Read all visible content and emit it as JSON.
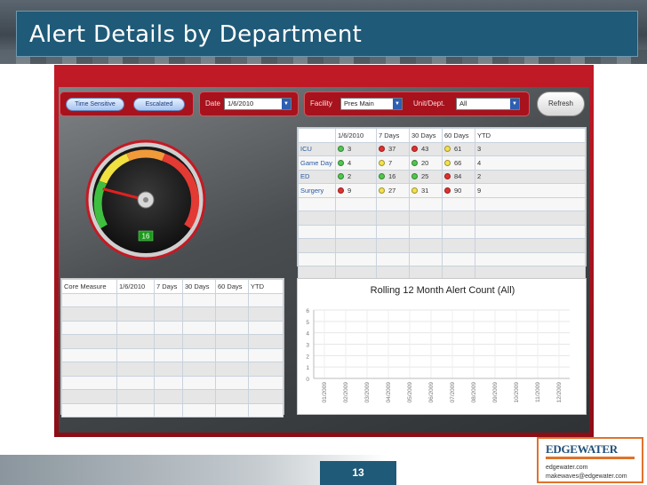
{
  "slide": {
    "title": "Alert Details by Department",
    "page_number": "13"
  },
  "toolbar": {
    "time_sensitive_label": "Time Sensitive",
    "escalated_label": "Escalated",
    "date_label": "Date",
    "date_value": "1/6/2010",
    "facility_label": "Facility",
    "facility_value": "Pres Main",
    "unit_label": "Unit/Dept.",
    "unit_value": "All",
    "refresh_label": "Refresh"
  },
  "gauge": {
    "value_label": "16",
    "fraction": 0.22
  },
  "dept_table": {
    "headers": [
      "",
      "1/6/2010",
      "7 Days",
      "30 Days",
      "60 Days",
      "YTD"
    ],
    "rows": [
      {
        "name": "ICU",
        "cells": [
          {
            "status": "green",
            "value": "3"
          },
          {
            "status": "red",
            "value": "37"
          },
          {
            "status": "red",
            "value": "43"
          },
          {
            "status": "yellow",
            "value": "61"
          }
        ],
        "ytd": "3"
      },
      {
        "name": "Game Day",
        "cells": [
          {
            "status": "green",
            "value": "4"
          },
          {
            "status": "yellow",
            "value": "7"
          },
          {
            "status": "green",
            "value": "20"
          },
          {
            "status": "yellow",
            "value": "66"
          }
        ],
        "ytd": "4"
      },
      {
        "name": "ED",
        "cells": [
          {
            "status": "green",
            "value": "2"
          },
          {
            "status": "green",
            "value": "16"
          },
          {
            "status": "green",
            "value": "25"
          },
          {
            "status": "red",
            "value": "84"
          }
        ],
        "ytd": "2"
      },
      {
        "name": "Surgery",
        "cells": [
          {
            "status": "red",
            "value": "9"
          },
          {
            "status": "yellow",
            "value": "27"
          },
          {
            "status": "yellow",
            "value": "31"
          },
          {
            "status": "red",
            "value": "90"
          }
        ],
        "ytd": "9"
      }
    ],
    "empty_rows": 6
  },
  "core_table": {
    "headers": [
      "Core Measure",
      "1/6/2010",
      "7 Days",
      "30 Days",
      "60 Days",
      "YTD"
    ],
    "empty_rows": 9
  },
  "chart_data": {
    "type": "line",
    "title": "Rolling 12 Month Alert Count (All)",
    "categories": [
      "01/2009",
      "02/2009",
      "03/2009",
      "04/2009",
      "05/2009",
      "06/2009",
      "07/2009",
      "08/2009",
      "09/2009",
      "10/2009",
      "11/2009",
      "12/2009"
    ],
    "series": [],
    "ylim": [
      0,
      6
    ],
    "yticks": [
      "0",
      "1",
      "2",
      "3",
      "4",
      "5",
      "6"
    ],
    "grid": true
  },
  "brand": {
    "logo_text": "EDGEWATER",
    "website": "edgewater.com",
    "email": "makewaves@edgewater.com"
  },
  "colors": {
    "title_bar": "#1f5a78",
    "dashboard_red": "#c11a26",
    "status_green": "#4fc84f",
    "status_yellow": "#f3e24a",
    "status_red": "#e2312e",
    "brand_orange": "#e0722a"
  }
}
